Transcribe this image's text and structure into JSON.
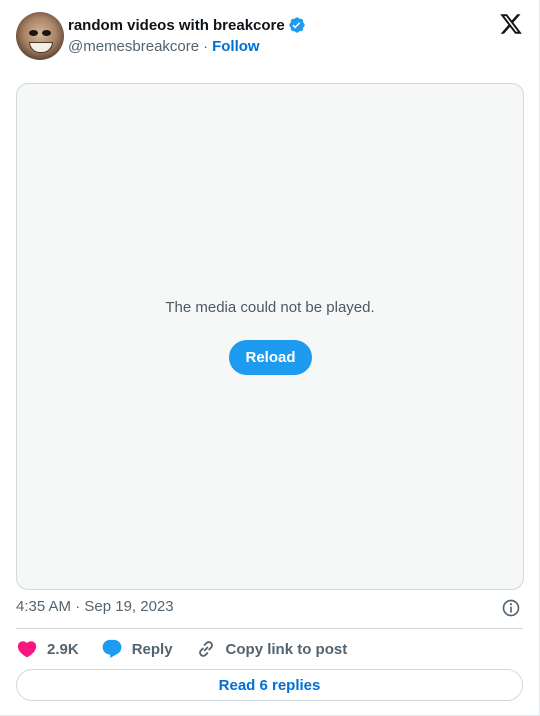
{
  "author": {
    "display_name": "random videos with breakcore",
    "handle": "@memesbreakcore",
    "separator": "·",
    "follow_label": "Follow",
    "verified": true
  },
  "media": {
    "message": "The media could not be played.",
    "reload_label": "Reload"
  },
  "timestamp": "4:35 AM · Sep 19, 2023",
  "actions": {
    "likes": "2.9K",
    "reply_label": "Reply",
    "copy_link_label": "Copy link to post"
  },
  "read_replies_label": "Read 6 replies",
  "icons": [
    "verified-badge-icon",
    "x-logo-icon",
    "info-icon",
    "heart-icon",
    "reply-bubble-icon",
    "link-icon"
  ],
  "colors": {
    "accent": "#1d9bf0",
    "link": "#006fd6",
    "heart": "#f91880",
    "muted_text": "#536471",
    "border": "#cfd9de",
    "media_bg": "#f6f8f7"
  }
}
